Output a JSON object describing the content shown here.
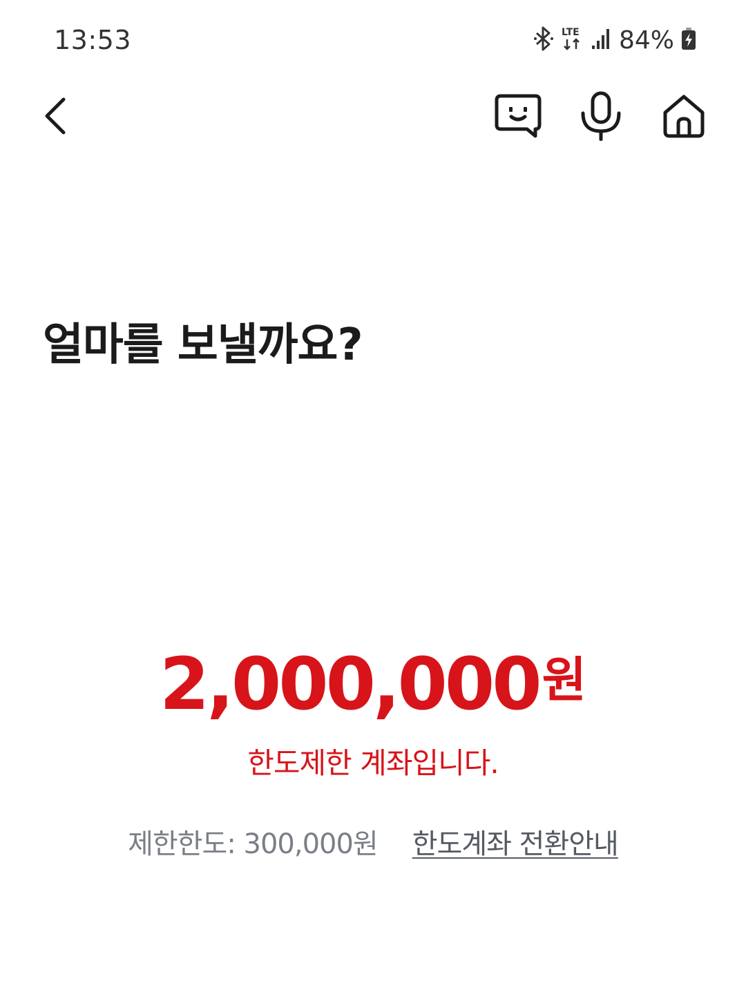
{
  "status_bar": {
    "time": "13:53",
    "network": "LTE",
    "battery": "84%",
    "icons": [
      "bluetooth-icon",
      "lte-icon",
      "signal-icon",
      "battery-charging-icon"
    ]
  },
  "nav": {
    "icons": [
      "back-icon",
      "chatbot-icon",
      "microphone-icon",
      "home-icon"
    ]
  },
  "page": {
    "title": "얼마를 보낼까요?"
  },
  "amount": {
    "value": "2,000,000",
    "unit": "원",
    "warning": "한도제한 계좌입니다."
  },
  "limit": {
    "label_value": "제한한도: 300,000원",
    "guide_link": "한도계좌 전환안내"
  },
  "colors": {
    "accent_red": "#d7141a",
    "title_text": "#1b1b1b",
    "muted_text": "#7a7f87"
  }
}
